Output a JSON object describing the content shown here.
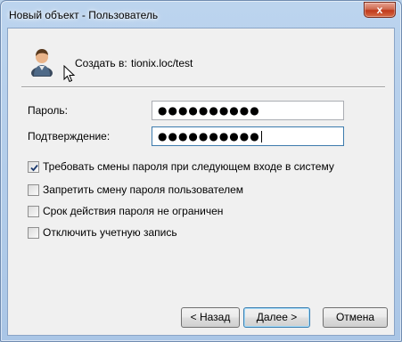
{
  "window": {
    "title": "Новый объект - Пользователь",
    "close_label": "x"
  },
  "header": {
    "create_label": "Создать в:",
    "create_path": "tionix.loc/test",
    "icon": "user-icon"
  },
  "form": {
    "password_label": "Пароль:",
    "password_value": "●●●●●●●●●●",
    "confirm_label": "Подтверждение:",
    "confirm_value": "●●●●●●●●●●"
  },
  "options": [
    {
      "label": "Требовать смены пароля при следующем входе в систему",
      "checked": true
    },
    {
      "label": "Запретить смену пароля пользователем",
      "checked": false
    },
    {
      "label": "Срок действия пароля не ограничен",
      "checked": false
    },
    {
      "label": "Отключить учетную запись",
      "checked": false
    }
  ],
  "buttons": {
    "back": "< Назад",
    "next": "Далее >",
    "cancel": "Отмена"
  }
}
